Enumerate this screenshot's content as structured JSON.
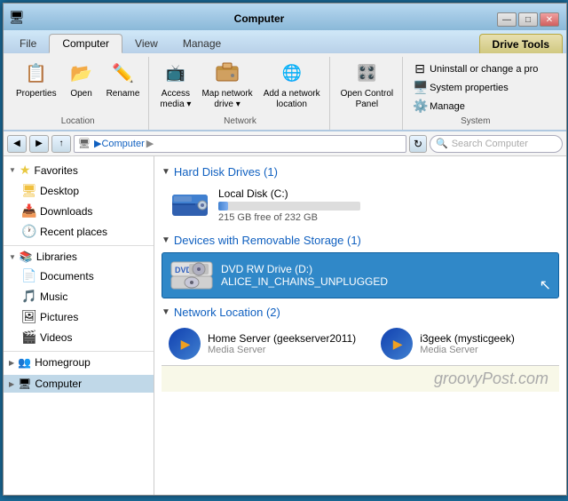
{
  "window": {
    "title": "Computer",
    "title_controls": {
      "minimize": "—",
      "maximize": "□",
      "close": "✕"
    }
  },
  "tabs": [
    {
      "id": "file",
      "label": "File",
      "active": false,
      "style": "inactive"
    },
    {
      "id": "computer",
      "label": "Computer",
      "active": true,
      "style": "active"
    },
    {
      "id": "view",
      "label": "View",
      "active": false,
      "style": "inactive"
    },
    {
      "id": "manage",
      "label": "Manage",
      "active": false,
      "style": "inactive"
    }
  ],
  "drive_tools_tab": "Drive Tools",
  "ribbon": {
    "groups": [
      {
        "id": "location",
        "label": "Location",
        "buttons": [
          {
            "id": "properties",
            "label": "Properties",
            "icon": "📋"
          },
          {
            "id": "open",
            "label": "Open",
            "icon": "📂"
          },
          {
            "id": "rename",
            "label": "Rename",
            "icon": "✏️"
          }
        ]
      },
      {
        "id": "network",
        "label": "Network",
        "buttons": [
          {
            "id": "access-media",
            "label": "Access\nmedia",
            "icon": "📺"
          },
          {
            "id": "map-network-drive",
            "label": "Map network\ndrive ▾",
            "icon": "🗺️"
          },
          {
            "id": "add-network-location",
            "label": "Add a network\nlocation",
            "icon": "🌐"
          }
        ]
      },
      {
        "id": "control-panel",
        "label": "",
        "buttons": [
          {
            "id": "open-control-panel",
            "label": "Open Control\nPanel",
            "icon": "🎛️"
          }
        ]
      },
      {
        "id": "system",
        "label": "System",
        "items": [
          {
            "id": "uninstall",
            "label": "Uninstall or change a pro",
            "icon": "⊟"
          },
          {
            "id": "system-properties",
            "label": "System properties",
            "icon": "🖥️"
          },
          {
            "id": "manage",
            "label": "Manage",
            "icon": "⚙️"
          }
        ]
      }
    ]
  },
  "address_bar": {
    "back_btn": "◀",
    "forward_btn": "▶",
    "up_btn": "↑",
    "path": "Computer",
    "path_arrow": "▶",
    "refresh_btn": "↻",
    "search_placeholder": "Search Computer"
  },
  "sidebar": {
    "favorites_label": "Favorites",
    "items_favorites": [
      {
        "id": "desktop",
        "label": "Desktop",
        "icon": "🖥"
      },
      {
        "id": "downloads",
        "label": "Downloads",
        "icon": "📥"
      },
      {
        "id": "recent",
        "label": "Recent places",
        "icon": "🕐"
      }
    ],
    "libraries_label": "Libraries",
    "items_libraries": [
      {
        "id": "documents",
        "label": "Documents",
        "icon": "📄"
      },
      {
        "id": "music",
        "label": "Music",
        "icon": "🎵"
      },
      {
        "id": "pictures",
        "label": "Pictures",
        "icon": "🖼"
      },
      {
        "id": "videos",
        "label": "Videos",
        "icon": "🎬"
      }
    ],
    "homegroup_label": "Homegroup",
    "computer_label": "Computer"
  },
  "main": {
    "hdd_section": "Hard Disk Drives (1)",
    "hdd_arrow": "▼",
    "local_disk": {
      "name": "Local Disk (C:)",
      "free": "215 GB free of 232 GB",
      "fill_pct": 7
    },
    "removable_section": "Devices with Removable Storage (1)",
    "removable_arrow": "▼",
    "dvd_drive": {
      "name": "DVD RW Drive (D:)",
      "label": "ALICE_IN_CHAINS_UNPLUGGED"
    },
    "network_section": "Network Location (2)",
    "network_arrow": "▼",
    "network_items": [
      {
        "id": "home-server",
        "name": "Home Server (geekserver2011)",
        "sublabel": "Media Server"
      },
      {
        "id": "i3geek",
        "name": "i3geek (mysticgeek)",
        "sublabel": "Media Server"
      }
    ]
  },
  "footer": {
    "text": "groovyPost.com"
  }
}
